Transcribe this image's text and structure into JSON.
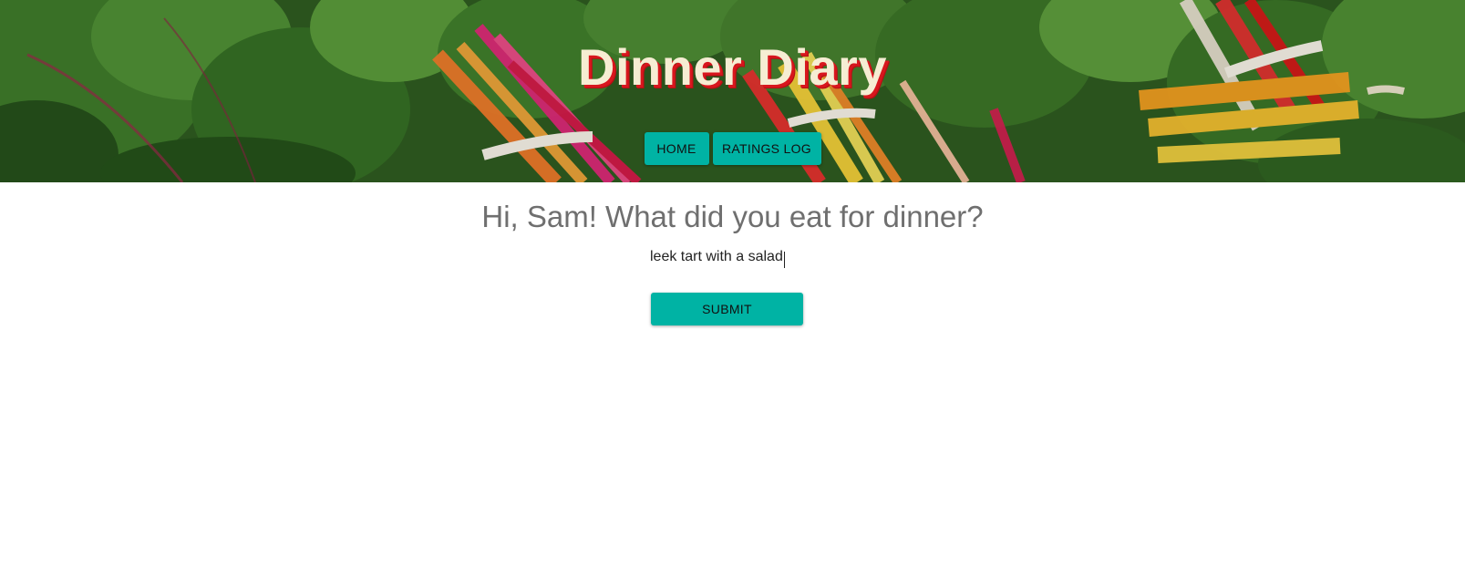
{
  "header": {
    "title": "Dinner Diary",
    "hero_image": "rainbow-chard-photo",
    "nav": [
      {
        "label": "HOME"
      },
      {
        "label": "RATINGS LOG"
      }
    ]
  },
  "main": {
    "prompt": "Hi, Sam! What did you eat for dinner?",
    "input_value": "leek tart with a salad",
    "submit_label": "SUBMIT"
  },
  "colors": {
    "accent": "#00b3a4",
    "title_text": "#f6edd3",
    "title_shadow": "#d8161d",
    "prompt_text": "#6f6f6f"
  }
}
